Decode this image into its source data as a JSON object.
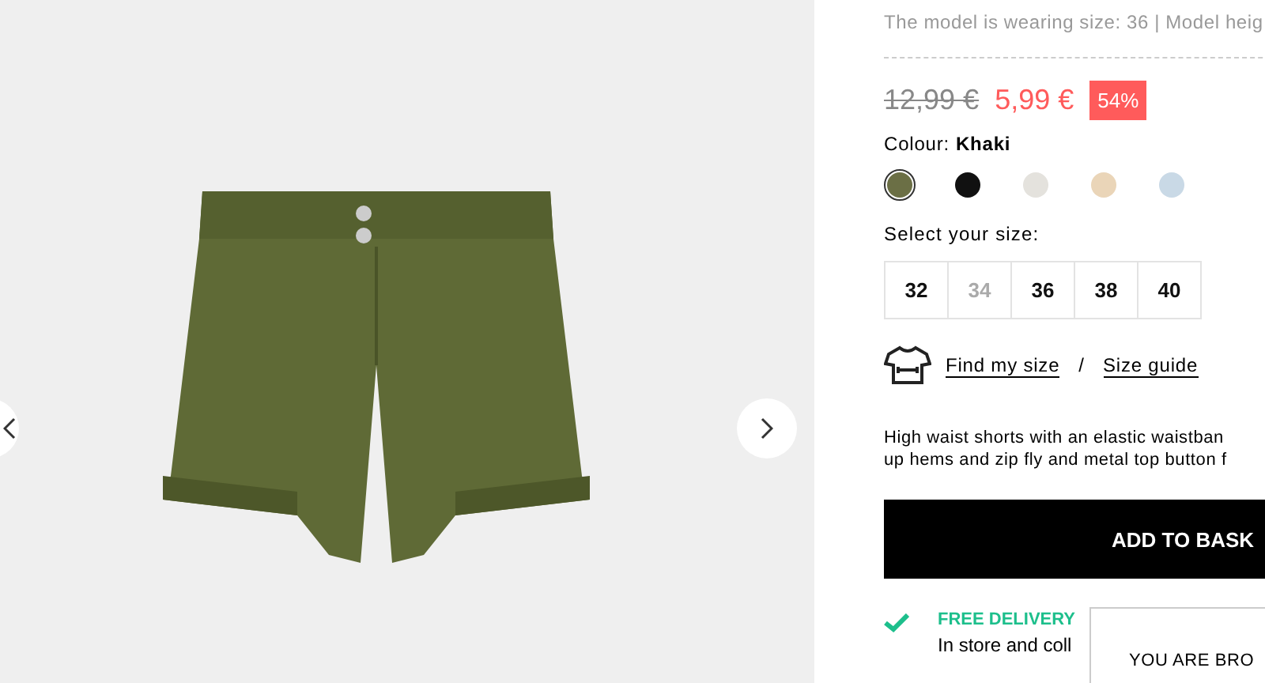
{
  "model_info": "The model is wearing size: 36 | Model heig",
  "price": {
    "old": "12,99 €",
    "current": "5,99 €",
    "discount": "54%"
  },
  "colour": {
    "label": "Colour:",
    "value": "Khaki"
  },
  "swatches": [
    {
      "color": "#6b6f45",
      "selected": true
    },
    {
      "color": "#111111",
      "selected": false
    },
    {
      "color": "#e4e2dd",
      "selected": false
    },
    {
      "color": "#ead5b8",
      "selected": false
    },
    {
      "color": "#c9d9e6",
      "selected": false
    }
  ],
  "size_label": "Select your size:",
  "sizes": [
    {
      "label": "32",
      "disabled": false
    },
    {
      "label": "34",
      "disabled": true
    },
    {
      "label": "36",
      "disabled": false
    },
    {
      "label": "38",
      "disabled": false
    },
    {
      "label": "40",
      "disabled": false
    }
  ],
  "size_links": {
    "find": "Find my size",
    "separator": "/",
    "guide": "Size guide"
  },
  "description": [
    "High waist shorts with an elastic waistban",
    "up hems and zip fly and metal top button f"
  ],
  "add_button": "ADD TO BASK",
  "delivery": {
    "title": "FREE DELIVERY",
    "subtitle": "In store and coll"
  },
  "popup": {
    "text": "YOU ARE BRO"
  }
}
